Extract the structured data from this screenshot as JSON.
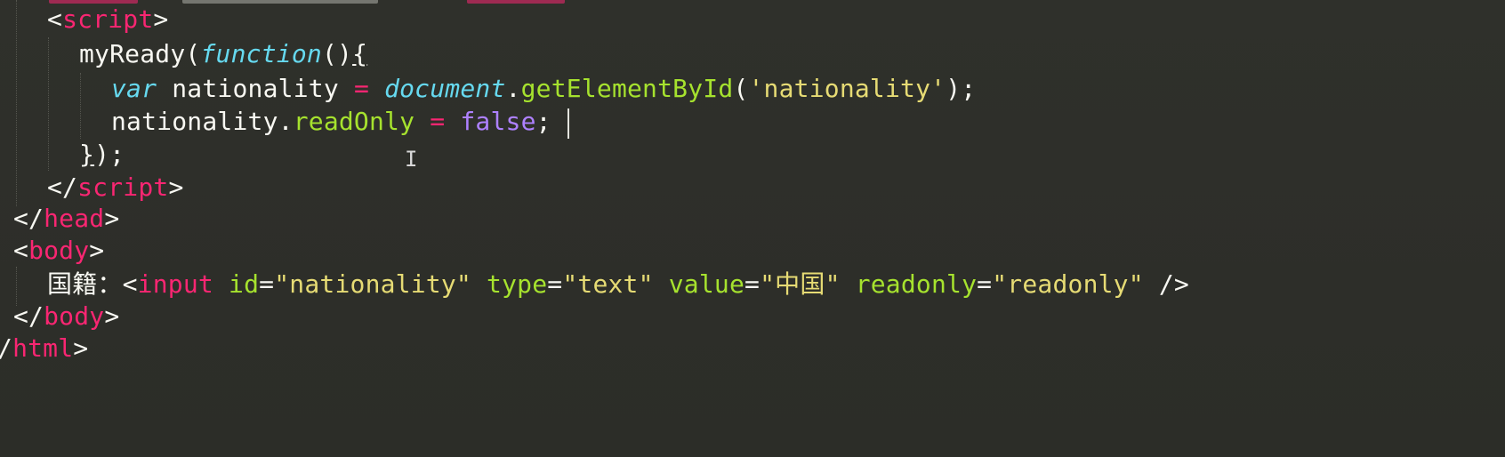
{
  "editor": {
    "background": "#2d2e29",
    "theme_colors": {
      "tag": "#f92672",
      "attribute": "#a6e22e",
      "string": "#e6db74",
      "keyword": "#66d9ef",
      "boolean": "#ae81ff",
      "text": "#f8f8f2"
    },
    "lines": [
      {
        "tokens": [
          {
            "t": "<",
            "c": "punc"
          },
          {
            "t": "script",
            "c": "tag"
          },
          {
            "t": ">",
            "c": "punc"
          }
        ]
      },
      {
        "tokens": [
          {
            "t": "myReady(",
            "c": "plain"
          },
          {
            "t": "function",
            "c": "kw"
          },
          {
            "t": "()",
            "c": "plain"
          },
          {
            "t": "{",
            "c": "brace"
          }
        ]
      },
      {
        "tokens": [
          {
            "t": "var",
            "c": "kw"
          },
          {
            "t": " nationality ",
            "c": "plain"
          },
          {
            "t": "=",
            "c": "op"
          },
          {
            "t": " ",
            "c": "plain"
          },
          {
            "t": "document",
            "c": "kw"
          },
          {
            "t": ".",
            "c": "plain"
          },
          {
            "t": "getElementById",
            "c": "fn"
          },
          {
            "t": "(",
            "c": "plain"
          },
          {
            "t": "'nationality'",
            "c": "str"
          },
          {
            "t": ");",
            "c": "plain"
          }
        ]
      },
      {
        "tokens": [
          {
            "t": "nationality.",
            "c": "plain"
          },
          {
            "t": "readOnly",
            "c": "fn"
          },
          {
            "t": " ",
            "c": "plain"
          },
          {
            "t": "=",
            "c": "op"
          },
          {
            "t": " ",
            "c": "plain"
          },
          {
            "t": "false",
            "c": "bool"
          },
          {
            "t": ";",
            "c": "plain"
          }
        ]
      },
      {
        "tokens": [
          {
            "t": "}",
            "c": "brace"
          },
          {
            "t": ");",
            "c": "plain"
          }
        ]
      },
      {
        "tokens": [
          {
            "t": "</",
            "c": "punc"
          },
          {
            "t": "script",
            "c": "tag"
          },
          {
            "t": ">",
            "c": "punc"
          }
        ]
      },
      {
        "tokens": [
          {
            "t": "</",
            "c": "punc"
          },
          {
            "t": "head",
            "c": "tag"
          },
          {
            "t": ">",
            "c": "punc"
          }
        ]
      },
      {
        "tokens": [
          {
            "t": "<",
            "c": "punc"
          },
          {
            "t": "body",
            "c": "tag"
          },
          {
            "t": ">",
            "c": "punc"
          }
        ]
      },
      {
        "tokens": [
          {
            "t": "国籍：",
            "c": "cjk"
          },
          {
            "t": "<",
            "c": "punc"
          },
          {
            "t": "input",
            "c": "tag"
          },
          {
            "t": " ",
            "c": "plain"
          },
          {
            "t": "id",
            "c": "attr"
          },
          {
            "t": "=",
            "c": "punc"
          },
          {
            "t": "\"nationality\"",
            "c": "str"
          },
          {
            "t": " ",
            "c": "plain"
          },
          {
            "t": "type",
            "c": "attr"
          },
          {
            "t": "=",
            "c": "punc"
          },
          {
            "t": "\"text\"",
            "c": "str"
          },
          {
            "t": " ",
            "c": "plain"
          },
          {
            "t": "value",
            "c": "attr"
          },
          {
            "t": "=",
            "c": "punc"
          },
          {
            "t": "\"中国\"",
            "c": "str"
          },
          {
            "t": " ",
            "c": "plain"
          },
          {
            "t": "readonly",
            "c": "attr"
          },
          {
            "t": "=",
            "c": "punc"
          },
          {
            "t": "\"readonly\"",
            "c": "str"
          },
          {
            "t": " />",
            "c": "punc"
          }
        ]
      },
      {
        "tokens": [
          {
            "t": "</",
            "c": "punc"
          },
          {
            "t": "body",
            "c": "tag"
          },
          {
            "t": ">",
            "c": "punc"
          }
        ]
      },
      {
        "tokens": [
          {
            "t": "/",
            "c": "punc"
          },
          {
            "t": "html",
            "c": "tag"
          },
          {
            "t": ">",
            "c": "punc"
          }
        ]
      }
    ]
  }
}
